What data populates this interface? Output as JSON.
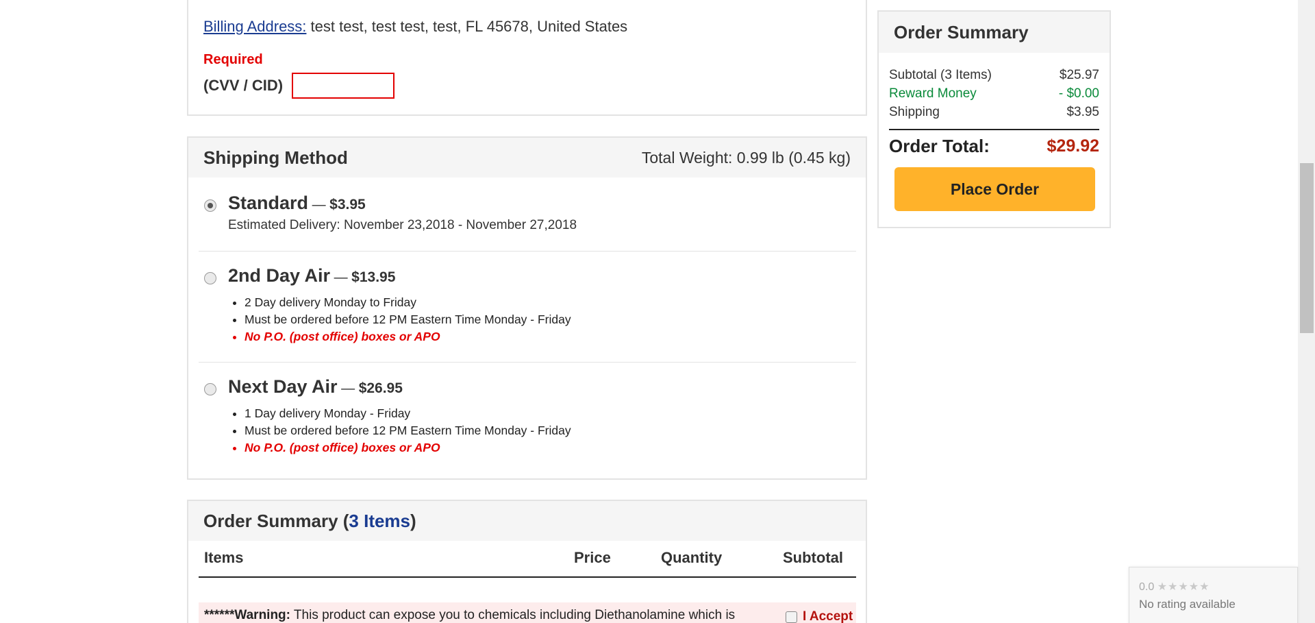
{
  "billing": {
    "label": "Billing Address:",
    "address": " test test, test test, test, FL 45678, United States",
    "required": "Required",
    "cvv_label": "(CVV / CID)",
    "cvv_value": ""
  },
  "shipping": {
    "title": "Shipping Method",
    "total_weight": "Total Weight: 0.99 lb (0.45 kg)",
    "options": [
      {
        "name": "Standard",
        "dash": " — ",
        "price": "$3.95",
        "selected": true,
        "estimate": "Estimated Delivery: November 23,2018 - November 27,2018"
      },
      {
        "name": "2nd Day Air",
        "dash": " — ",
        "price": "$13.95",
        "selected": false,
        "bullets": [
          "2 Day delivery Monday to Friday",
          "Must be ordered before 12 PM Eastern Time Monday - Friday",
          "No P.O. (post office) boxes or APO"
        ]
      },
      {
        "name": "Next Day Air",
        "dash": " — ",
        "price": "$26.95",
        "selected": false,
        "bullets": [
          "1 Day delivery Monday - Friday",
          "Must be ordered before 12 PM Eastern Time Monday - Friday",
          "No P.O. (post office) boxes or APO"
        ]
      }
    ]
  },
  "items_summary": {
    "title_prefix": "Order Summary (",
    "count": "3 Items",
    "title_suffix": ")",
    "columns": [
      "Items",
      "Price",
      "Quantity",
      "Subtotal"
    ],
    "warning_prefix": "******",
    "warning_bold": "Warning:",
    "warning_text": " This product can expose you to chemicals including Diethanolamine which is",
    "accept_label": "I Accept"
  },
  "order_summary": {
    "title": "Order Summary",
    "rows": [
      {
        "label": "Subtotal (3 Items)",
        "value": "$25.97"
      },
      {
        "label": "Reward Money",
        "value": "- $0.00"
      },
      {
        "label": "Shipping",
        "value": "$3.95"
      }
    ],
    "total_label": "Order Total:",
    "total_value": "$29.92",
    "place_order": "Place Order"
  },
  "rating_widget": {
    "score": "0.0",
    "stars": "★★★★★",
    "text": "No rating available"
  },
  "colors": {
    "accent_blue": "#1a3c91",
    "required_red": "#e30000",
    "reward_green": "#0a8a3a",
    "total_red": "#b4250e",
    "button_orange": "#ffb22a"
  }
}
